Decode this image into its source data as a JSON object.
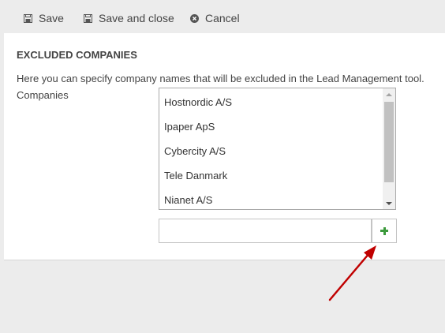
{
  "toolbar": {
    "save_label": "Save",
    "save_close_label": "Save and close",
    "cancel_label": "Cancel"
  },
  "section": {
    "title": "EXCLUDED COMPANIES",
    "description": "Here you can specify company names that will be excluded in the Lead Management tool.",
    "field_label": "Companies"
  },
  "companies": {
    "items": [
      "Hostnordic A/S",
      "Ipaper ApS",
      "Cybercity A/S",
      "Tele Danmark",
      "Nianet A/S"
    ]
  },
  "add_field": {
    "value": "",
    "placeholder": ""
  },
  "colors": {
    "plus_green": "#3c9a3c",
    "annotation_arrow": "#c00000"
  },
  "icons": {
    "save": "floppy-disk-icon",
    "save_close": "floppy-disk-icon",
    "cancel": "close-circle-icon",
    "add": "plus-icon"
  }
}
